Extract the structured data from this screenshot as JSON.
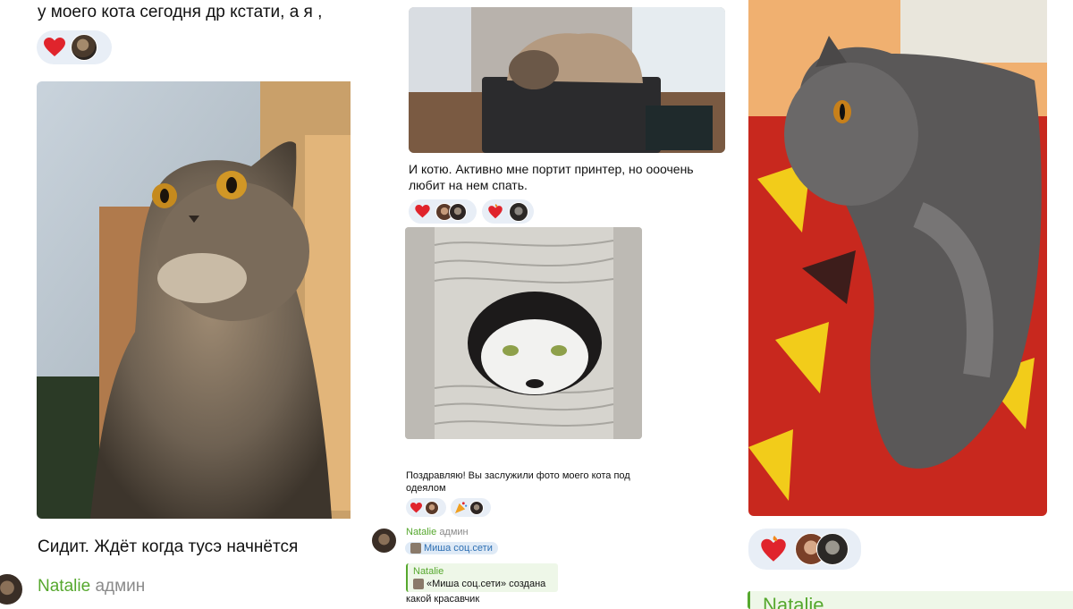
{
  "col1": {
    "caption_top": "у моего кота сегодня др кстати, а я ,",
    "reactions": {
      "emoji": "❤️"
    },
    "caption_bottom": "Сидит. Ждёт когда тусэ начнётся",
    "author": {
      "name": "Natalie",
      "role": "админ"
    }
  },
  "col2": {
    "caption": "И котю. Активно мне портит принтер, но ооочень любит на нем спать.",
    "reactions1": [
      {
        "emoji": "❤️"
      },
      {
        "emoji": "❤️‍🔥"
      }
    ],
    "caption2": "Поздравляю! Вы заслужили фото моего кота под одеялом",
    "reactions2": [
      {
        "emoji": "❤️"
      },
      {
        "emoji": "🎉"
      }
    ],
    "author": {
      "name": "Natalie",
      "role": "админ"
    },
    "tag": "Миша соц.сети",
    "reply": {
      "name": "Natalie",
      "text": "«Миша соц.сети» создана"
    },
    "last_line": "какой красавчик"
  },
  "col3": {
    "reactions": {
      "emoji": "❤️‍🔥"
    },
    "author": {
      "name": "Natalie"
    }
  },
  "colors": {
    "accent_green": "#56a82e",
    "pill_bg": "#e8eef6",
    "heart": "#e0242c"
  }
}
